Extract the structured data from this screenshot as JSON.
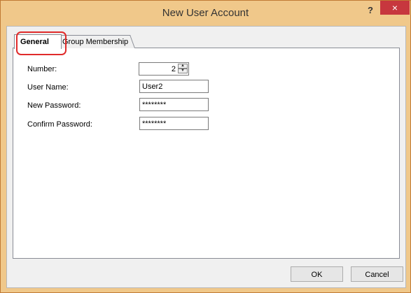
{
  "window": {
    "title": "New User Account",
    "help_label": "?",
    "close_label": "×"
  },
  "tabs": [
    {
      "label": "General",
      "selected": true
    },
    {
      "label": "Group Membership",
      "selected": false
    }
  ],
  "form": {
    "number_label": "Number:",
    "number_value": "2",
    "username_label": "User Name:",
    "username_value": "User2",
    "new_password_label": "New Password:",
    "new_password_value": "********",
    "confirm_password_label": "Confirm Password:",
    "confirm_password_value": "********"
  },
  "buttons": {
    "ok": "OK",
    "cancel": "Cancel"
  },
  "icons": {
    "spin_up": "up-arrow",
    "spin_down": "down-arrow"
  },
  "colors": {
    "titlebar": "#f0c88a",
    "close": "#c7373e",
    "highlight": "#e02b2b"
  }
}
